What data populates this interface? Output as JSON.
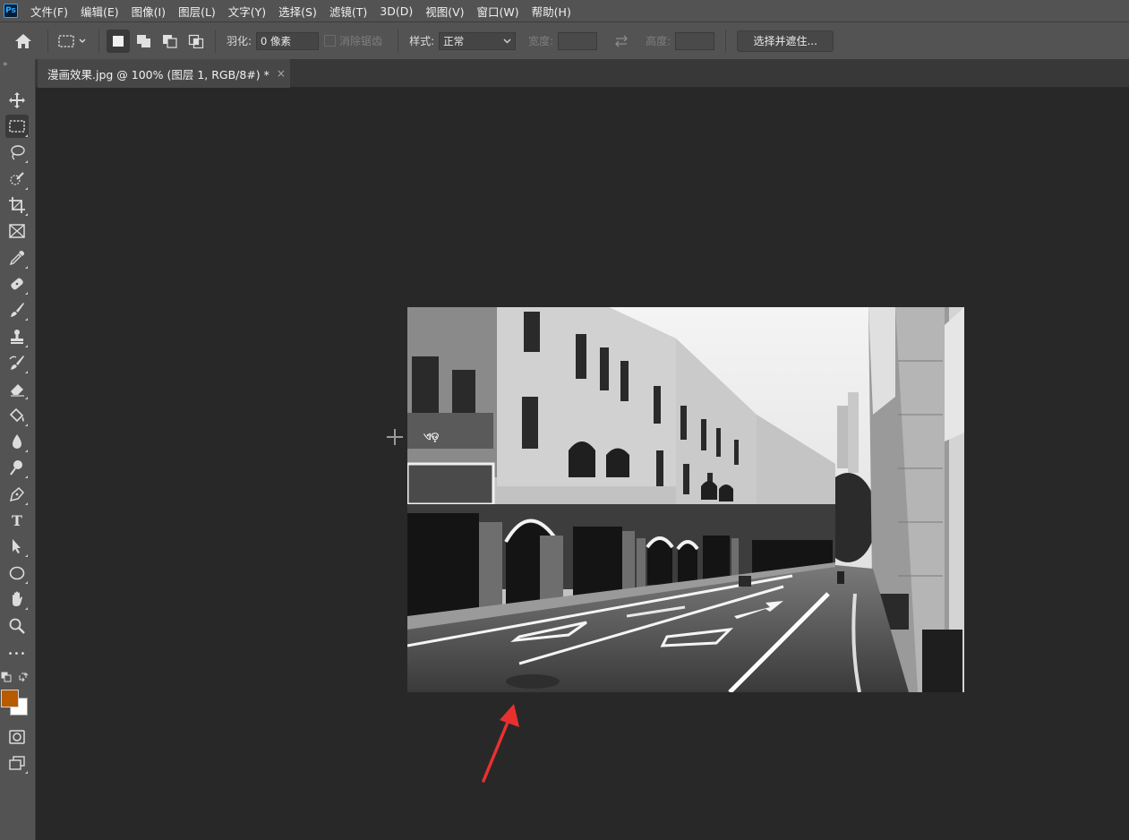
{
  "app": {
    "logo_text": "Ps",
    "accent": "#31a8ff"
  },
  "menu": [
    "文件(F)",
    "编辑(E)",
    "图像(I)",
    "图层(L)",
    "文字(Y)",
    "选择(S)",
    "滤镜(T)",
    "3D(D)",
    "视图(V)",
    "窗口(W)",
    "帮助(H)"
  ],
  "options": {
    "feather_label": "羽化:",
    "feather_value": "0 像素",
    "antialias_label": "消除锯齿",
    "style_label": "样式:",
    "style_value": "正常",
    "width_label": "宽度:",
    "height_label": "高度:",
    "select_mask_button": "选择并遮住..."
  },
  "document_tab": {
    "title": "漫画效果.jpg @ 100% (图层 1, RGB/8#) *",
    "close": "×"
  },
  "colors": {
    "foreground": "#b75a00",
    "background": "#ffffff",
    "annotation_arrow": "#e8312f"
  },
  "tools": [
    "move-icon",
    "rect-marquee-icon",
    "lasso-icon",
    "quick-select-icon",
    "crop-icon",
    "frame-icon",
    "eyedropper-icon",
    "healing-brush-icon",
    "brush-icon",
    "clone-stamp-icon",
    "history-brush-icon",
    "eraser-icon",
    "paint-bucket-icon",
    "blur-icon",
    "dodge-icon",
    "pen-icon",
    "type-tool-icon",
    "path-select-icon",
    "ellipse-icon",
    "hand-icon",
    "zoom-icon",
    "more-tools-icon"
  ],
  "type_tool_glyph": "T",
  "more_tools_glyph": "•••"
}
